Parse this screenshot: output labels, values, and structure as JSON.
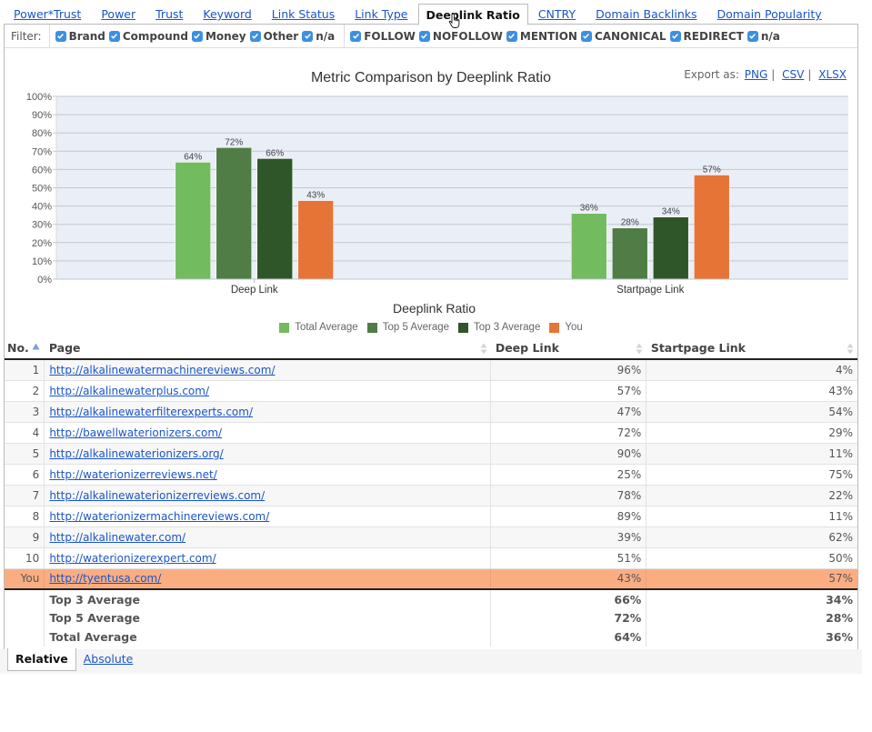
{
  "tabs": [
    {
      "label": "Power*Trust",
      "active": false
    },
    {
      "label": "Power",
      "active": false
    },
    {
      "label": "Trust",
      "active": false
    },
    {
      "label": "Keyword",
      "active": false
    },
    {
      "label": "Link Status",
      "active": false
    },
    {
      "label": "Link Type",
      "active": false
    },
    {
      "label": "Deeplink Ratio",
      "active": true
    },
    {
      "label": "CNTRY",
      "active": false
    },
    {
      "label": "Domain Backlinks",
      "active": false
    },
    {
      "label": "Domain Popularity",
      "active": false
    }
  ],
  "filter": {
    "label": "Filter:",
    "anchor_types": [
      {
        "label": "Brand",
        "checked": true
      },
      {
        "label": "Compound",
        "checked": true
      },
      {
        "label": "Money",
        "checked": true
      },
      {
        "label": "Other",
        "checked": true
      },
      {
        "label": "n/a",
        "checked": true
      }
    ],
    "link_types": [
      {
        "label": "FOLLOW",
        "checked": true
      },
      {
        "label": "NOFOLLOW",
        "checked": true
      },
      {
        "label": "MENTION",
        "checked": true
      },
      {
        "label": "CANONICAL",
        "checked": true
      },
      {
        "label": "REDIRECT",
        "checked": true
      },
      {
        "label": "n/a",
        "checked": true
      }
    ]
  },
  "export": {
    "label": "Export as:",
    "png": "PNG",
    "csv": "CSV",
    "xlsx": "XLSX",
    "separator": "|"
  },
  "colors": {
    "total_average": "#72bb5f",
    "top5_average": "#4f7d45",
    "top3_average": "#2f5628",
    "you": "#e67436",
    "you_row": "#fbad82",
    "plot_bg": "#eaeef6",
    "link": "#1a55c9",
    "checkbox": "#3d8fe0"
  },
  "chart_data": {
    "type": "bar",
    "title": "Metric Comparison by Deeplink Ratio",
    "xlabel": "Deeplink Ratio",
    "ylabel": "",
    "categories": [
      "Deep Link",
      "Startpage Link"
    ],
    "series": [
      {
        "name": "Total Average",
        "values": [
          64,
          36
        ]
      },
      {
        "name": "Top 5 Average",
        "values": [
          72,
          28
        ]
      },
      {
        "name": "Top 3 Average",
        "values": [
          66,
          34
        ]
      },
      {
        "name": "You",
        "values": [
          43,
          57
        ]
      }
    ],
    "ylim": [
      0,
      100
    ],
    "yticks": [
      "0%",
      "10%",
      "20%",
      "30%",
      "40%",
      "50%",
      "60%",
      "70%",
      "80%",
      "90%",
      "100%"
    ],
    "data_label_suffix": "%",
    "grid": true,
    "legend": "bottom-center"
  },
  "table": {
    "columns": [
      {
        "label": "No.",
        "sort": "asc"
      },
      {
        "label": "Page",
        "sort": "none"
      },
      {
        "label": "Deep Link",
        "sort": "none"
      },
      {
        "label": "Startpage Link",
        "sort": "none"
      }
    ],
    "rows": [
      {
        "no": "1",
        "page": "http://alkalinewatermachinereviews.com/",
        "deep": "96%",
        "start": "4%"
      },
      {
        "no": "2",
        "page": "http://alkalinewaterplus.com/",
        "deep": "57%",
        "start": "43%"
      },
      {
        "no": "3",
        "page": "http://alkalinewaterfilterexperts.com/",
        "deep": "47%",
        "start": "54%"
      },
      {
        "no": "4",
        "page": "http://bawellwaterionizers.com/",
        "deep": "72%",
        "start": "29%"
      },
      {
        "no": "5",
        "page": "http://alkalinewaterionizers.org/",
        "deep": "90%",
        "start": "11%"
      },
      {
        "no": "6",
        "page": "http://waterionizerreviews.net/",
        "deep": "25%",
        "start": "75%"
      },
      {
        "no": "7",
        "page": "http://alkalinewaterionizerreviews.com/",
        "deep": "78%",
        "start": "22%"
      },
      {
        "no": "8",
        "page": "http://waterionizermachinereviews.com/",
        "deep": "89%",
        "start": "11%"
      },
      {
        "no": "9",
        "page": "http://alkalinewater.com/",
        "deep": "39%",
        "start": "62%"
      },
      {
        "no": "10",
        "page": "http://waterionizerexpert.com/",
        "deep": "51%",
        "start": "50%"
      }
    ],
    "you_row": {
      "no": "You",
      "page": "http://tyentusa.com/",
      "deep": "43%",
      "start": "57%"
    },
    "averages": [
      {
        "label": "Top 3 Average",
        "deep": "66%",
        "start": "34%"
      },
      {
        "label": "Top 5 Average",
        "deep": "72%",
        "start": "28%"
      },
      {
        "label": "Total Average",
        "deep": "64%",
        "start": "36%"
      }
    ]
  },
  "bottom_tabs": [
    {
      "label": "Relative",
      "active": true
    },
    {
      "label": "Absolute",
      "active": false
    }
  ]
}
